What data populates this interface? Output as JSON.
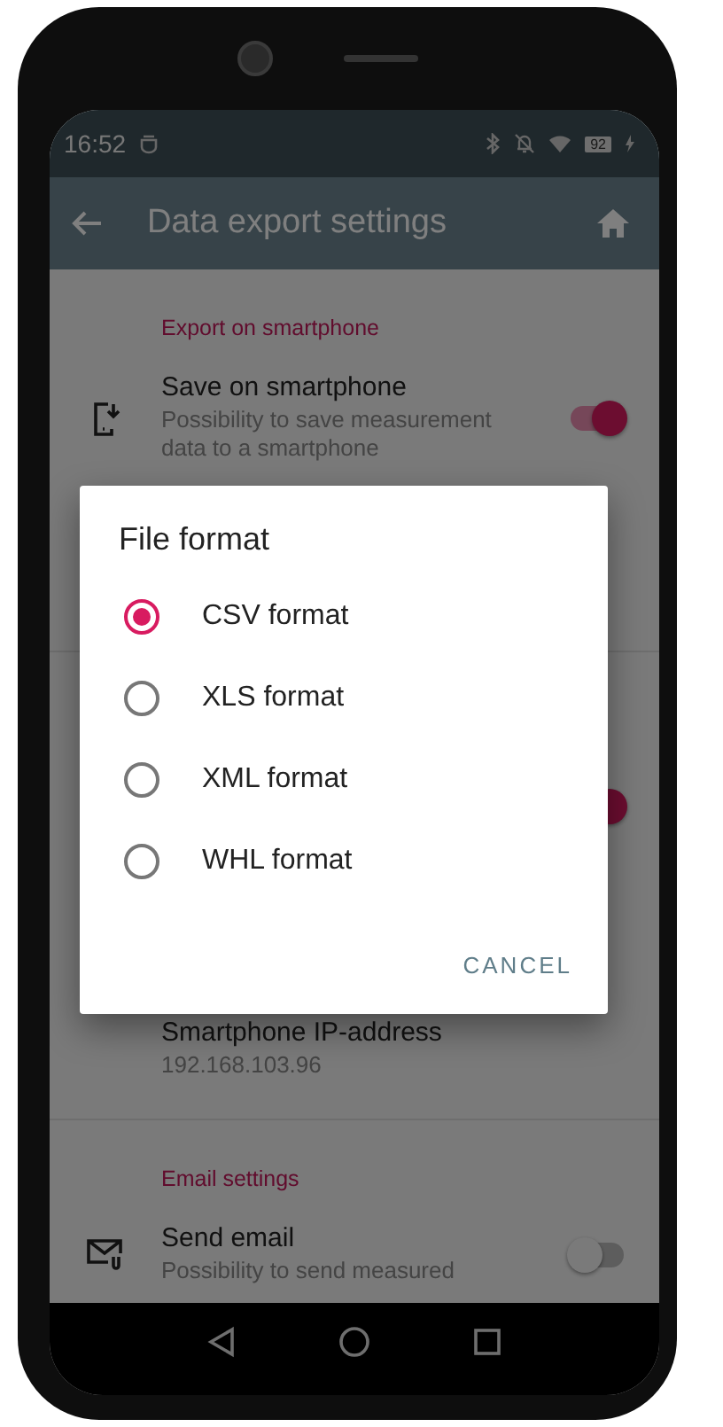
{
  "status_bar": {
    "time": "16:52",
    "battery": "92"
  },
  "app_bar": {
    "title": "Data export settings"
  },
  "sections": [
    {
      "header": "Export on smartphone",
      "items": [
        {
          "kind": "switch",
          "title": "Save on smartphone",
          "summary": "Possibility to save measurement data to a smartphone",
          "on": true
        },
        {
          "kind": "covered"
        },
        {
          "kind": "covered-switch",
          "on": true
        },
        {
          "kind": "text",
          "title": "Smartphone IP-address",
          "summary": "192.168.103.96"
        }
      ]
    },
    {
      "header": "Email settings",
      "items": [
        {
          "kind": "switch",
          "title": "Send email",
          "summary": "Possibility to send measured",
          "on": false
        }
      ]
    }
  ],
  "dialog": {
    "title": "File format",
    "options": [
      {
        "label": "CSV format",
        "selected": true
      },
      {
        "label": "XLS format",
        "selected": false
      },
      {
        "label": "XML format",
        "selected": false
      },
      {
        "label": "WHL format",
        "selected": false
      }
    ],
    "button": "CANCEL"
  }
}
